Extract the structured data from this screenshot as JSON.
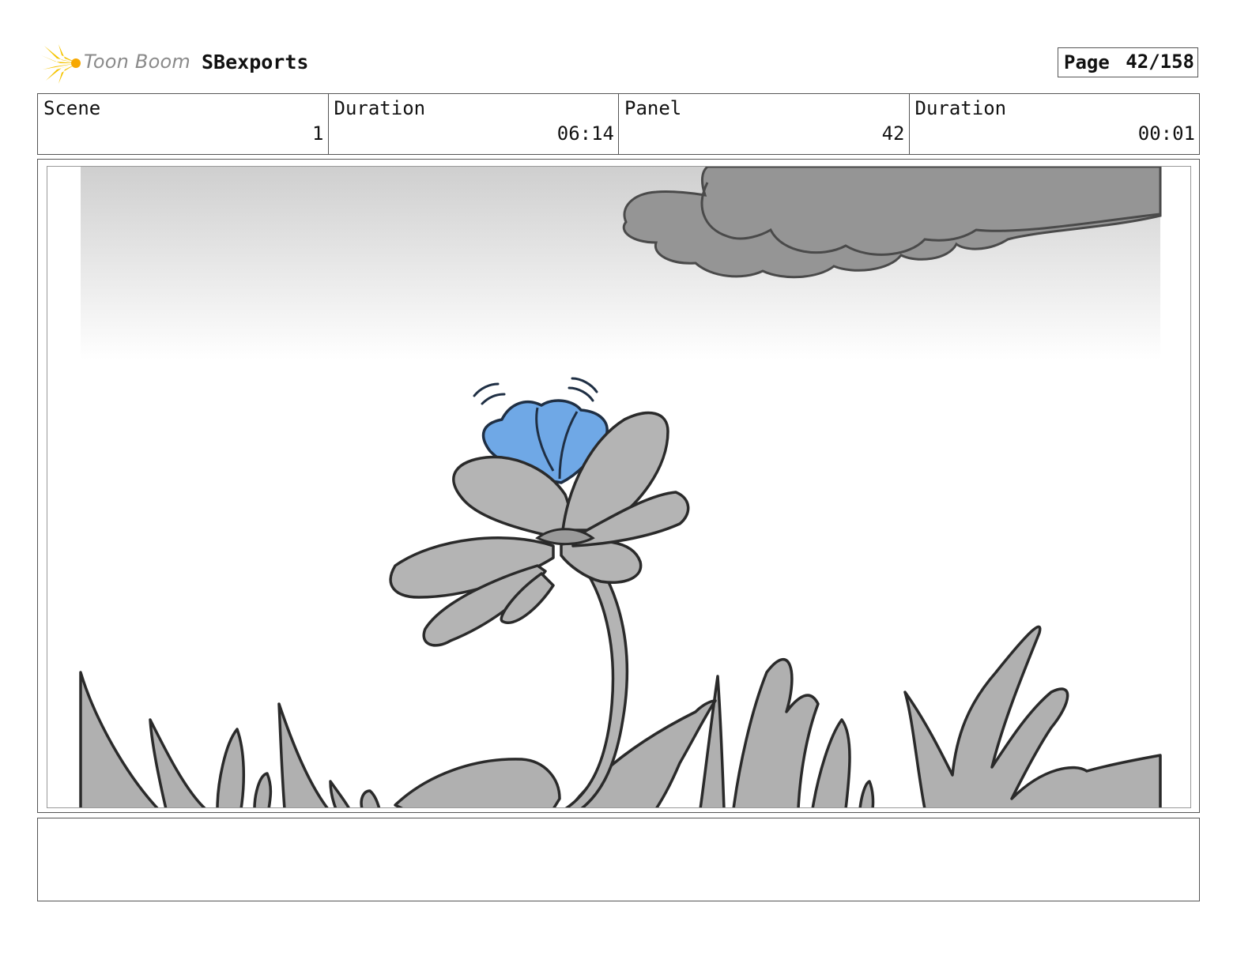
{
  "header": {
    "logo_text": "Toon Boom",
    "project_title": "SBexports",
    "page_label": "Page",
    "page_value": "42/158"
  },
  "info": {
    "scene_label": "Scene",
    "scene_value": "1",
    "scene_duration_label": "Duration",
    "scene_duration_value": "06:14",
    "panel_label": "Panel",
    "panel_value": "42",
    "panel_duration_label": "Duration",
    "panel_duration_value": "00:01"
  },
  "colors": {
    "logo_yellow": "#f5c400",
    "sky_top": "#cfcfcf",
    "cloud": "#959595",
    "flower_gray": "#b4b4b4",
    "bud_blue": "#6fa8e6",
    "grass": "#b0b0b0",
    "line": "#2a2a2a"
  },
  "notes": {
    "text": ""
  }
}
